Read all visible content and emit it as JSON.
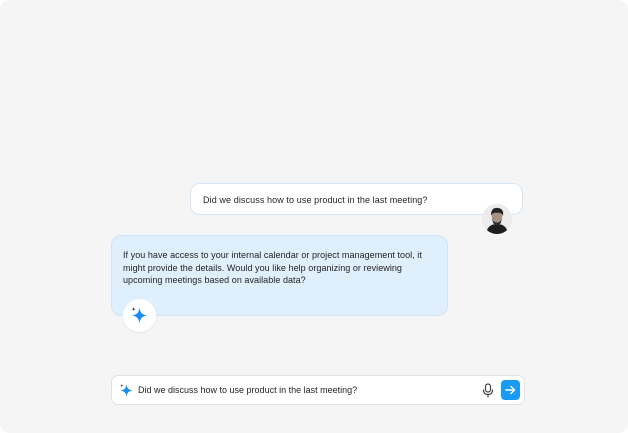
{
  "conversation": {
    "user_message": "Did we discuss how to use product in the last meeting?",
    "assistant_message": " If you have access to your internal calendar or project management tool, it might provide the details. Would you like help organizing or reviewing upcoming meetings based on available data?"
  },
  "composer": {
    "value": "Did we discuss how to use product in the last meeting?",
    "mic_icon": "microphone-icon",
    "send_icon": "arrow-right-icon",
    "assistant_icon": "sparkle-icon"
  },
  "colors": {
    "background": "#f5f5f5",
    "assistant_bubble": "#e0effc",
    "accent": "#1a9af5"
  }
}
